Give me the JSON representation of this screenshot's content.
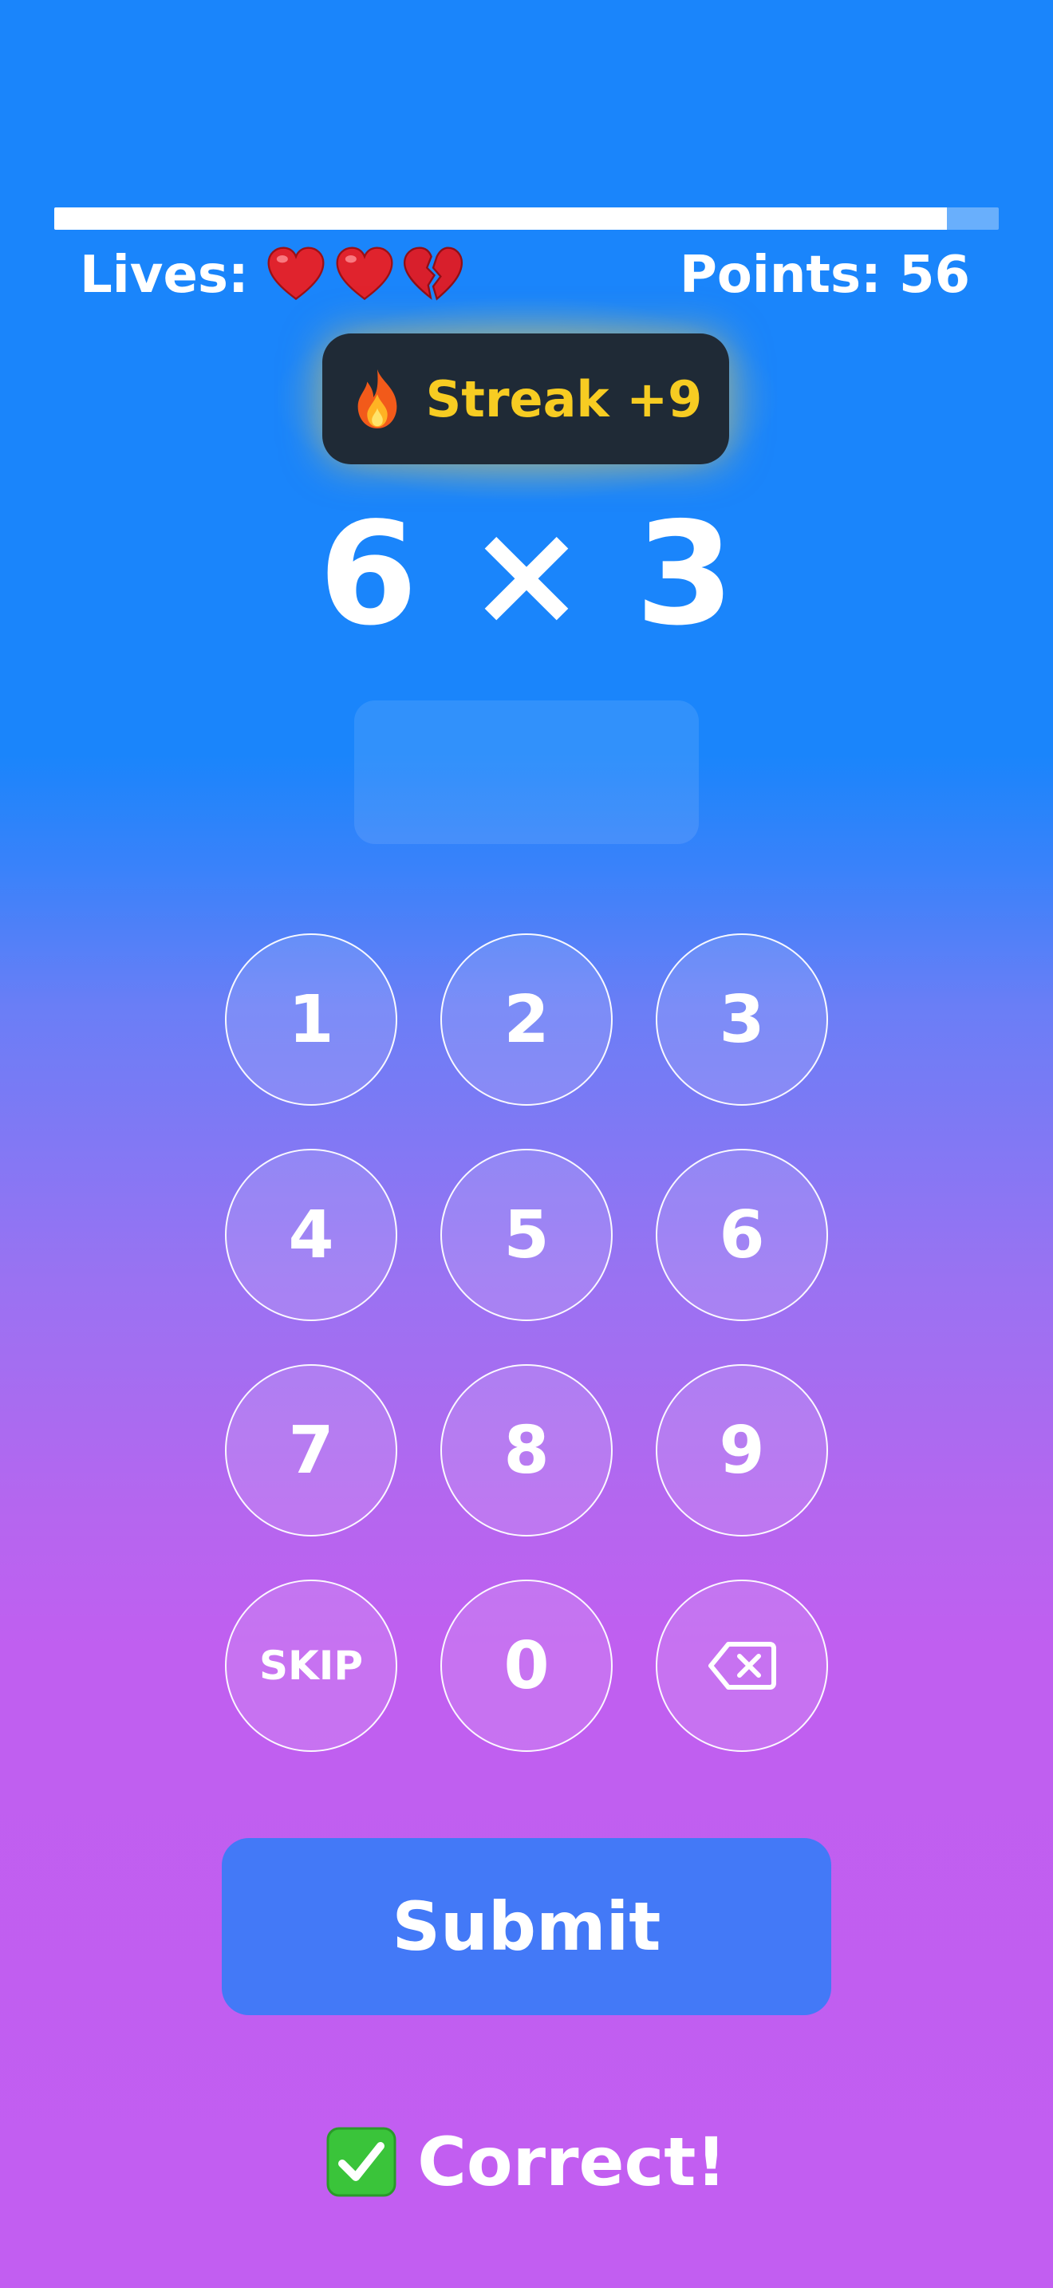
{
  "progress": {
    "value_percent": 94.5
  },
  "stats": {
    "lives_label": "Lives:",
    "hearts": [
      {
        "icon": "red-heart-icon",
        "state": "full"
      },
      {
        "icon": "red-heart-icon",
        "state": "full"
      },
      {
        "icon": "broken-heart-icon",
        "state": "lost"
      }
    ],
    "points_text": "Points: 56"
  },
  "streak": {
    "icon": "fire-icon",
    "text": "Streak +9"
  },
  "problem": {
    "text": "6 × 3"
  },
  "answer": {
    "value": ""
  },
  "keypad": {
    "keys": [
      "1",
      "2",
      "3",
      "4",
      "5",
      "6",
      "7",
      "8",
      "9",
      "SKIP",
      "0"
    ],
    "backspace_icon": "backspace-icon"
  },
  "submit": {
    "label": "Submit"
  },
  "feedback": {
    "icon": "check-mark-icon",
    "text": "Correct!"
  },
  "colors": {
    "background_top": "#1a85fb",
    "background_bottom": "#c25ef1",
    "streak_badge": "#1f2a36",
    "streak_text": "#f7cc22",
    "submit_button": "#4379f7",
    "heart": "#e0232d",
    "check": "#3ac43a"
  }
}
